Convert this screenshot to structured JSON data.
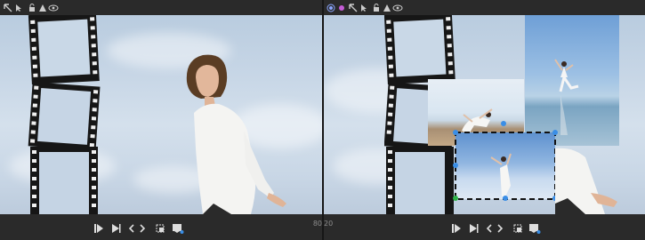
{
  "left_panel": {
    "toolbar_icons": [
      "select-icon",
      "pointer-icon",
      "lock-icon",
      "warning-icon",
      "eye-icon"
    ]
  },
  "right_panel": {
    "toolbar_icons": [
      "radio-icon",
      "magenta-dot-icon",
      "select-icon",
      "pointer-icon",
      "lock-icon",
      "warning-icon",
      "eye-icon"
    ]
  },
  "zoom": {
    "left_fragment": "80",
    "right_fragment": "20"
  },
  "bottom_controls": [
    "play-start-icon",
    "play-icon",
    "prev-icon",
    "next-icon",
    "crop-icon",
    "export-icon"
  ],
  "colors": {
    "chrome": "#2a2a2a",
    "film": "#161616",
    "selection": "#3a8ee6",
    "accent_magenta": "#c45cd6"
  }
}
